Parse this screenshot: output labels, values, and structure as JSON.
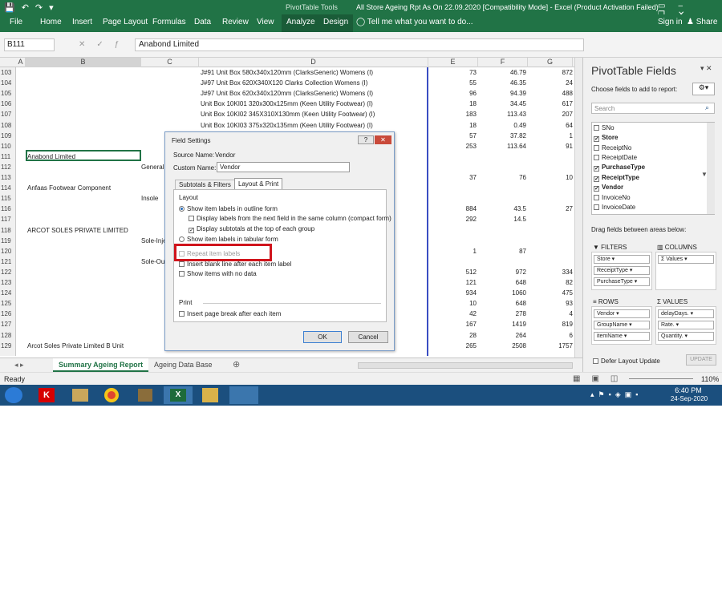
{
  "window": {
    "title": "All Store Ageing Rpt As On 22.09.2020  [Compatibility Mode]  - Excel (Product Activation Failed)",
    "context_tool": "PivotTable Tools"
  },
  "ribbon": {
    "tabs": [
      "File",
      "Home",
      "Insert",
      "Page Layout",
      "Formulas",
      "Data",
      "Review",
      "View",
      "Analyze",
      "Design"
    ],
    "tell_me": "Tell me what you want to do...",
    "sign_in": "Sign in",
    "share": "Share"
  },
  "formula": {
    "namebox": "B111",
    "value": "Anabond Limited"
  },
  "columns": [
    "A",
    "B",
    "C",
    "D",
    "E",
    "F",
    "G"
  ],
  "rows": [
    "103",
    "104",
    "105",
    "106",
    "107",
    "108",
    "109",
    "110",
    "111",
    "112",
    "113",
    "114",
    "115",
    "116",
    "117",
    "118",
    "119",
    "120",
    "121",
    "122",
    "123",
    "124",
    "125",
    "126",
    "127",
    "128",
    "129"
  ],
  "grid": {
    "d": [
      "J#91 Unit Box 580x340x120mm (ClarksGeneric) Womens (I)",
      "J#97 Unit Box 620X340X120 Clarks Collection Womens (I)",
      "J#97 Unit Box 620x340x120mm (ClarksGeneric) Womens (I)",
      "Unit Box 10KI01 320x300x125mm (Keen Utility Footwear) (I)",
      "Unit Box 10KI02 345X310X130mm (Keen Utility Footwear) (I)",
      "Unit Box 10KI03 375x320x135mm (Keen Utility Footwear) (I)"
    ],
    "e": [
      "73",
      "55",
      "96",
      "18",
      "183",
      "18",
      "57",
      "253",
      "",
      "",
      "37",
      "",
      "",
      "884",
      "292",
      "",
      "",
      "1",
      "",
      "512",
      "121",
      "934",
      "10",
      "42",
      "167",
      "28",
      "265"
    ],
    "f": [
      "46.79",
      "46.35",
      "94.39",
      "34.45",
      "113.43",
      "0.49",
      "37.82",
      "113.64",
      "",
      "",
      "76",
      "",
      "",
      "43.5",
      "14.5",
      "",
      "",
      "87",
      "",
      "972",
      "648",
      "1060",
      "648",
      "278",
      "1419",
      "264",
      "2508"
    ],
    "g": [
      "872",
      "24",
      "488",
      "617",
      "207",
      "64",
      "1",
      "91",
      "",
      "",
      "10",
      "",
      "",
      "27",
      "",
      "",
      "",
      "",
      "",
      "334",
      "82",
      "475",
      "93",
      "4",
      "819",
      "6",
      "1757"
    ],
    "b": [
      {
        "row": 8,
        "text": "Anabond Limited"
      },
      {
        "row": 11,
        "text": "Anfaas Footwear Component"
      },
      {
        "row": 15,
        "text": "ARCOT SOLES PRIVATE LIMITED"
      },
      {
        "row": 26,
        "text": "Arcot Soles Private Limited B Unit"
      }
    ],
    "c": [
      {
        "row": 9,
        "text": "General"
      },
      {
        "row": 12,
        "text": "Insole"
      },
      {
        "row": 16,
        "text": "Sole-Inje"
      },
      {
        "row": 18,
        "text": "Sole-Out"
      }
    ]
  },
  "sheets": {
    "active": "Summary Ageing Report",
    "other": "Ageing Data Base"
  },
  "status": {
    "left": "Ready",
    "zoom": "110%"
  },
  "taskbar": {
    "time": "6:40 PM",
    "date": "24-Sep-2020"
  },
  "pane": {
    "title": "PivotTable Fields",
    "choose": "Choose fields to add to report:",
    "search": "Search",
    "fields": [
      {
        "name": "SNo",
        "checked": false
      },
      {
        "name": "Store",
        "checked": true
      },
      {
        "name": "ReceiptNo",
        "checked": false
      },
      {
        "name": "ReceiptDate",
        "checked": false
      },
      {
        "name": "PurchaseType",
        "checked": true
      },
      {
        "name": "ReceiptType",
        "checked": true
      },
      {
        "name": "Vendor",
        "checked": true
      },
      {
        "name": "InvoiceNo",
        "checked": false
      },
      {
        "name": "InvoiceDate",
        "checked": false
      }
    ],
    "drag": "Drag fields between areas below:",
    "filters_label": "FILTERS",
    "columns_label": "COLUMNS",
    "rows_label": "ROWS",
    "values_label": "VALUES",
    "filters": [
      "Store",
      "ReceiptType",
      "PurchaseType"
    ],
    "columns": [
      "Σ Values"
    ],
    "rows": [
      "Vendor",
      "GroupName",
      "itemName"
    ],
    "values": [
      "delayDays.",
      "Rate.",
      "Quantity."
    ],
    "defer": "Defer Layout Update",
    "update": "UPDATE"
  },
  "dialog": {
    "title": "Field Settings",
    "source_label": "Source Name:",
    "source_value": "Vendor",
    "custom_label": "Custom Name:",
    "custom_value": "Vendor",
    "tab1": "Subtotals & Filters",
    "tab2": "Layout & Print",
    "layout": "Layout",
    "opt1": "Show item labels in outline form",
    "opt2": "Display labels from the next field in the same column (compact form)",
    "opt3": "Display subtotals at the top of each group",
    "opt4": "Show item labels in tabular form",
    "opt5": "Repeat item labels",
    "opt6": "Insert blank line after each item label",
    "opt7": "Show items with no data",
    "print": "Print",
    "opt8": "Insert page break after each item",
    "ok": "OK",
    "cancel": "Cancel",
    "highlight_color": "#d0141c"
  }
}
